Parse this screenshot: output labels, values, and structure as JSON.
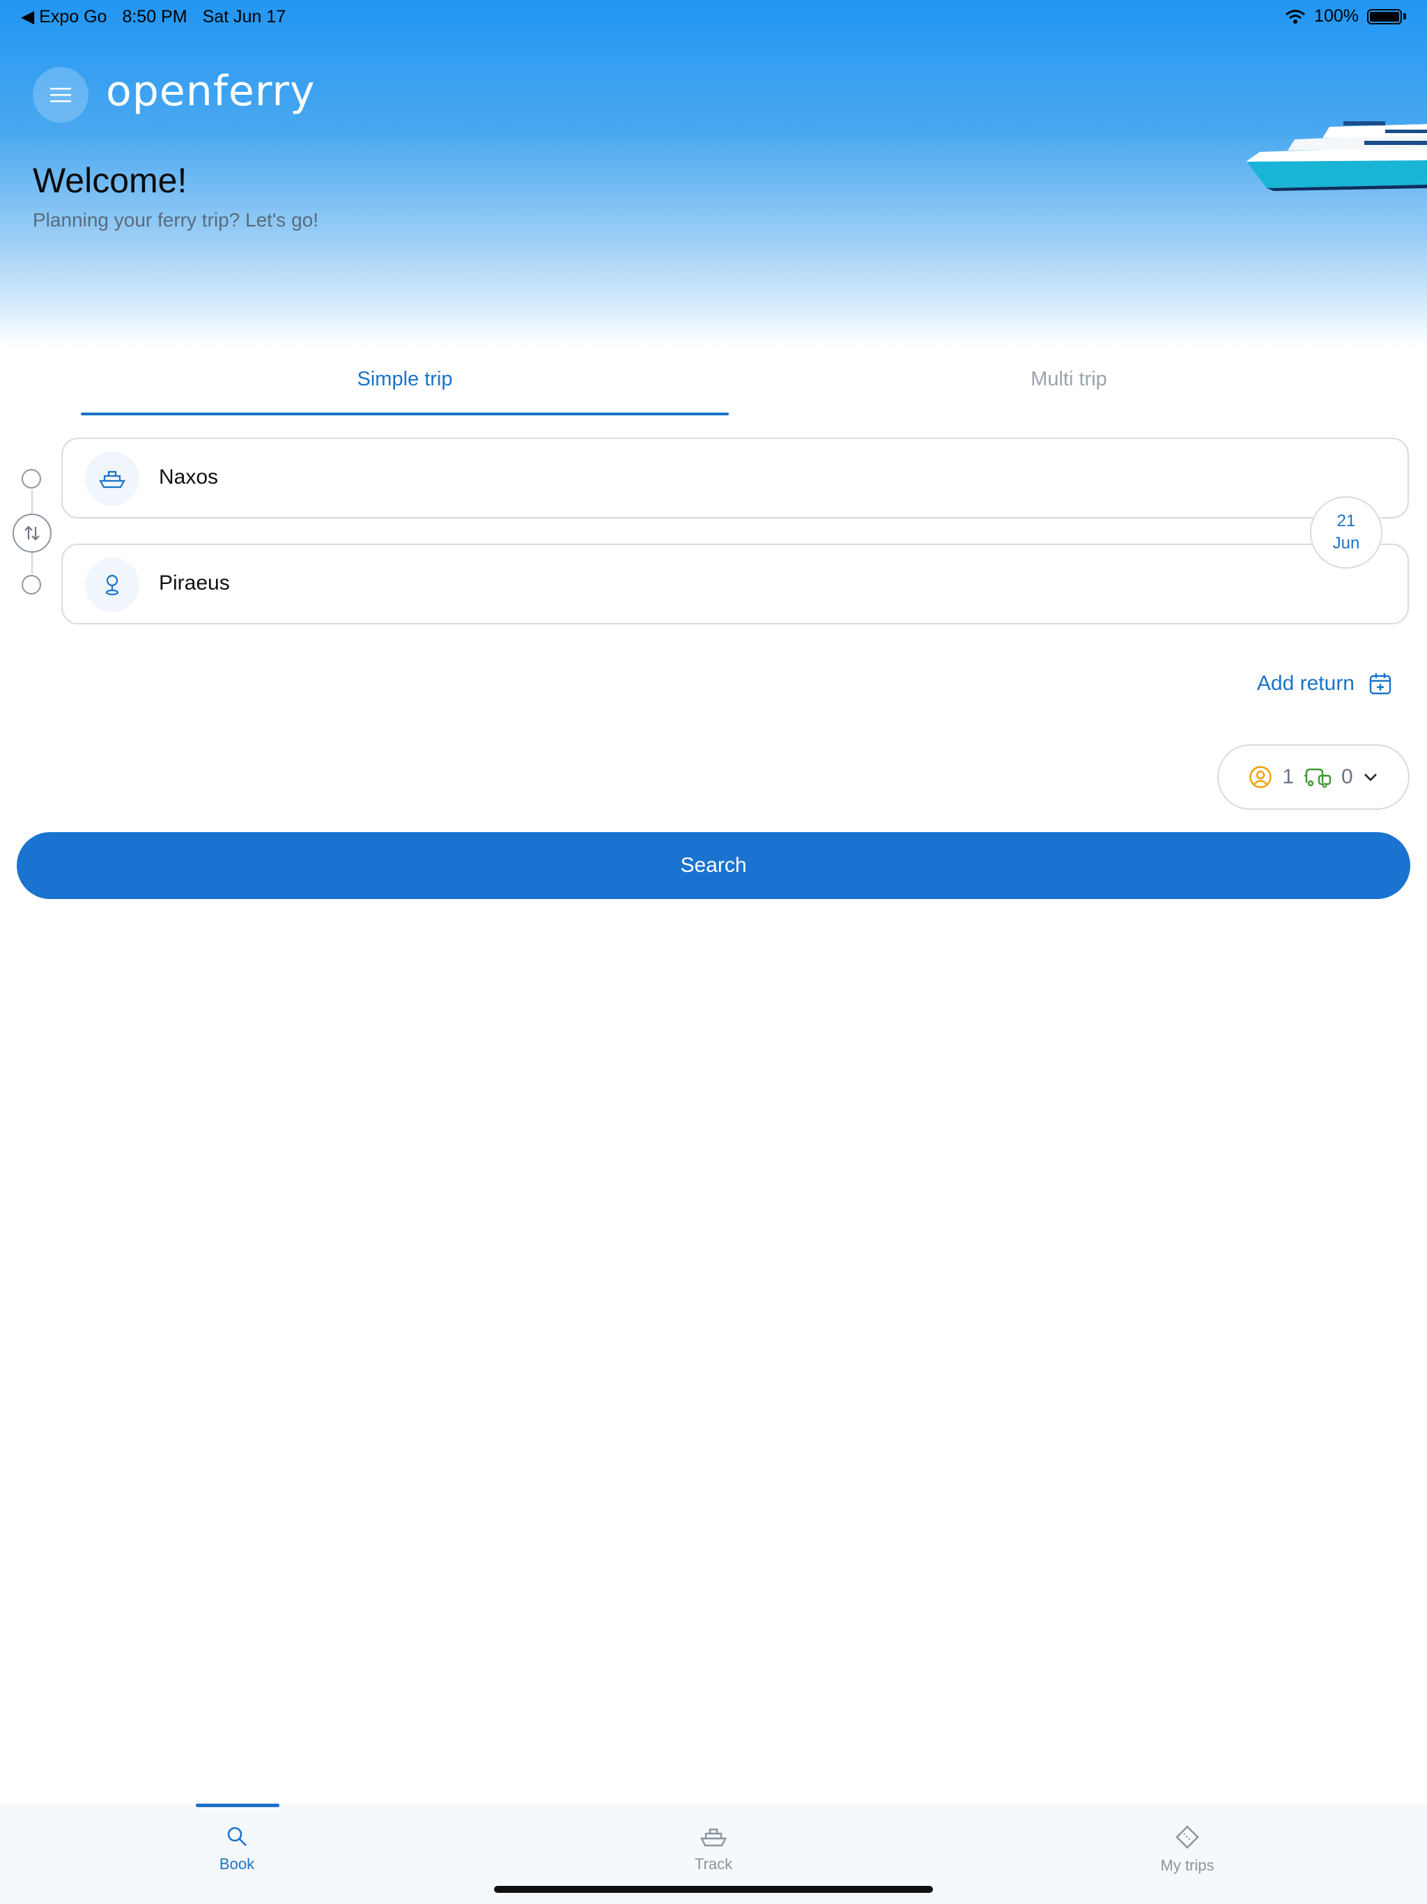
{
  "status_bar": {
    "back_app": "◀ Expo Go",
    "time": "8:50 PM",
    "date": "Sat Jun 17",
    "battery": "100%"
  },
  "header": {
    "brand": "openferry",
    "welcome": "Welcome!",
    "subtitle": "Planning your ferry trip? Let's go!"
  },
  "tabs": [
    {
      "label": "Simple trip",
      "active": true
    },
    {
      "label": "Multi trip",
      "active": false
    }
  ],
  "trip": {
    "origin": "Naxos",
    "destination": "Piraeus",
    "date_day": "21",
    "date_month": "Jun"
  },
  "add_return_label": "Add return",
  "passengers": {
    "people": "1",
    "vehicles": "0"
  },
  "search_label": "Search",
  "bottom_nav": [
    {
      "label": "Book",
      "icon": "search-icon",
      "active": true
    },
    {
      "label": "Track",
      "icon": "ferry-icon",
      "active": false
    },
    {
      "label": "My trips",
      "icon": "ticket-icon",
      "active": false
    }
  ],
  "colors": {
    "primary": "#1a73c8",
    "hero_top": "#2196f3",
    "passenger_icon": "#f0a000",
    "vehicle_icon": "#3d9a2f"
  }
}
